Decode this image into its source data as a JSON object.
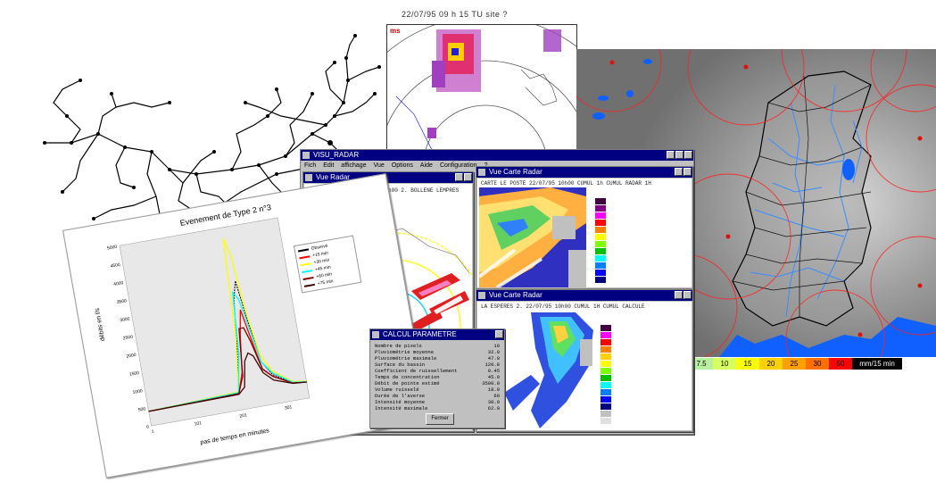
{
  "top_radar": {
    "header": "22/07/95 09 h 15 TU  site ?",
    "corner_label": "ms"
  },
  "chart": {
    "title": "Evenement de Type 2 n°3",
    "xlabel": "pas de temps en minutes",
    "ylabel": "débits en l/s",
    "legend": [
      "Observé",
      "+15 min",
      "+30 min",
      "+45 min",
      "+60 min",
      "+75 min"
    ],
    "legend_colors": [
      "#000000",
      "#ff0000",
      "#ffff00",
      "#00ffff",
      "#800000",
      "#400000"
    ]
  },
  "chart_data": {
    "type": "line",
    "title": "Evenement de Type 2 n°3",
    "xlabel": "pas de temps en minutes",
    "ylabel": "débits en l/s",
    "ylim": [
      0,
      5000
    ],
    "xlim": [
      0,
      350
    ],
    "yticks": [
      0,
      500,
      1000,
      1500,
      2000,
      2500,
      3000,
      3500,
      4000,
      4500,
      5000
    ],
    "xticks": [
      1,
      101,
      201,
      301
    ],
    "series": [
      {
        "name": "Observé",
        "x": [
          0,
          200,
          215,
          225,
          235,
          245,
          260,
          280,
          320,
          350
        ],
        "y": [
          400,
          500,
          1800,
          3000,
          3500,
          2500,
          1200,
          800,
          500,
          450
        ]
      },
      {
        "name": "+15 min",
        "x": [
          0,
          200,
          215,
          225,
          235,
          245,
          260,
          280,
          320,
          350
        ],
        "y": [
          400,
          450,
          1000,
          2000,
          2700,
          2000,
          1000,
          750,
          480,
          450
        ]
      },
      {
        "name": "+30 min",
        "x": [
          0,
          200,
          215,
          225,
          235,
          245,
          260,
          280,
          320,
          350
        ],
        "y": [
          400,
          500,
          2000,
          4700,
          4200,
          2700,
          1400,
          900,
          520,
          460
        ]
      },
      {
        "name": "+45 min",
        "x": [
          0,
          200,
          215,
          225,
          235,
          245,
          260,
          280,
          320,
          350
        ],
        "y": [
          400,
          480,
          1500,
          3200,
          3000,
          2300,
          1200,
          850,
          500,
          450
        ]
      },
      {
        "name": "+60 min",
        "x": [
          0,
          200,
          215,
          225,
          235,
          245,
          260,
          280,
          320,
          350
        ],
        "y": [
          400,
          450,
          900,
          2200,
          2200,
          1800,
          1000,
          750,
          480,
          440
        ]
      },
      {
        "name": "+75 min",
        "x": [
          0,
          200,
          215,
          225,
          235,
          245,
          260,
          280,
          320,
          350
        ],
        "y": [
          400,
          430,
          600,
          1300,
          1500,
          1400,
          900,
          650,
          470,
          440
        ]
      }
    ]
  },
  "app_window": {
    "title": "VISU_RADAR",
    "menu": [
      "Fich",
      "Edit",
      "affichage",
      "Vue",
      "Options",
      "Aide",
      "Configuration",
      "?"
    ],
    "panel_left": {
      "title": "Vue Radar",
      "header": "LA ESPERES 1. 22/07/95 10h00  2. BOLLENE  LEMPRES"
    },
    "panel_right_top": {
      "title": "Vue Carte Radar",
      "header": "CARTE LE POSTE 22/07/95 10h00 CUMUL 1h  CUMUL RADAR 1H"
    },
    "panel_right_bottom": {
      "title": "Vue Carte Radar",
      "header": "LA ESPERES 2. 22/07/95 10h00  CUMUL 1H  CUMUL CALCULE"
    },
    "dialog": {
      "title": "CALCUL PARAMETRE",
      "rows": [
        [
          "Nombre de pixels",
          "10"
        ],
        [
          "Pluviométrie moyenne",
          "32.0"
        ],
        [
          "Pluviométrie maximale",
          "47.0"
        ],
        [
          "Surface du bassin",
          "120.0"
        ],
        [
          "Coefficient de ruissellement",
          "0.45"
        ],
        [
          "Temps de concentration",
          "45.0"
        ],
        [
          "Débit de pointe estimé",
          "3500.0"
        ],
        [
          "Volume ruisselé",
          "18.0"
        ],
        [
          "Durée de l'averse",
          "60"
        ],
        [
          "Intensité moyenne",
          "30.0"
        ],
        [
          "Intensité maximale",
          "62.0"
        ]
      ],
      "button": "Fermer"
    }
  },
  "map": {
    "scale_values": [
      "7.5",
      "10",
      "15",
      "20",
      "25",
      "30",
      "50",
      "mm/15 min"
    ],
    "scale_colors": [
      "#b8f0a0",
      "#d8ff60",
      "#ffff00",
      "#ffd000",
      "#ffa000",
      "#ff7000",
      "#ff0000",
      "#000000"
    ]
  }
}
